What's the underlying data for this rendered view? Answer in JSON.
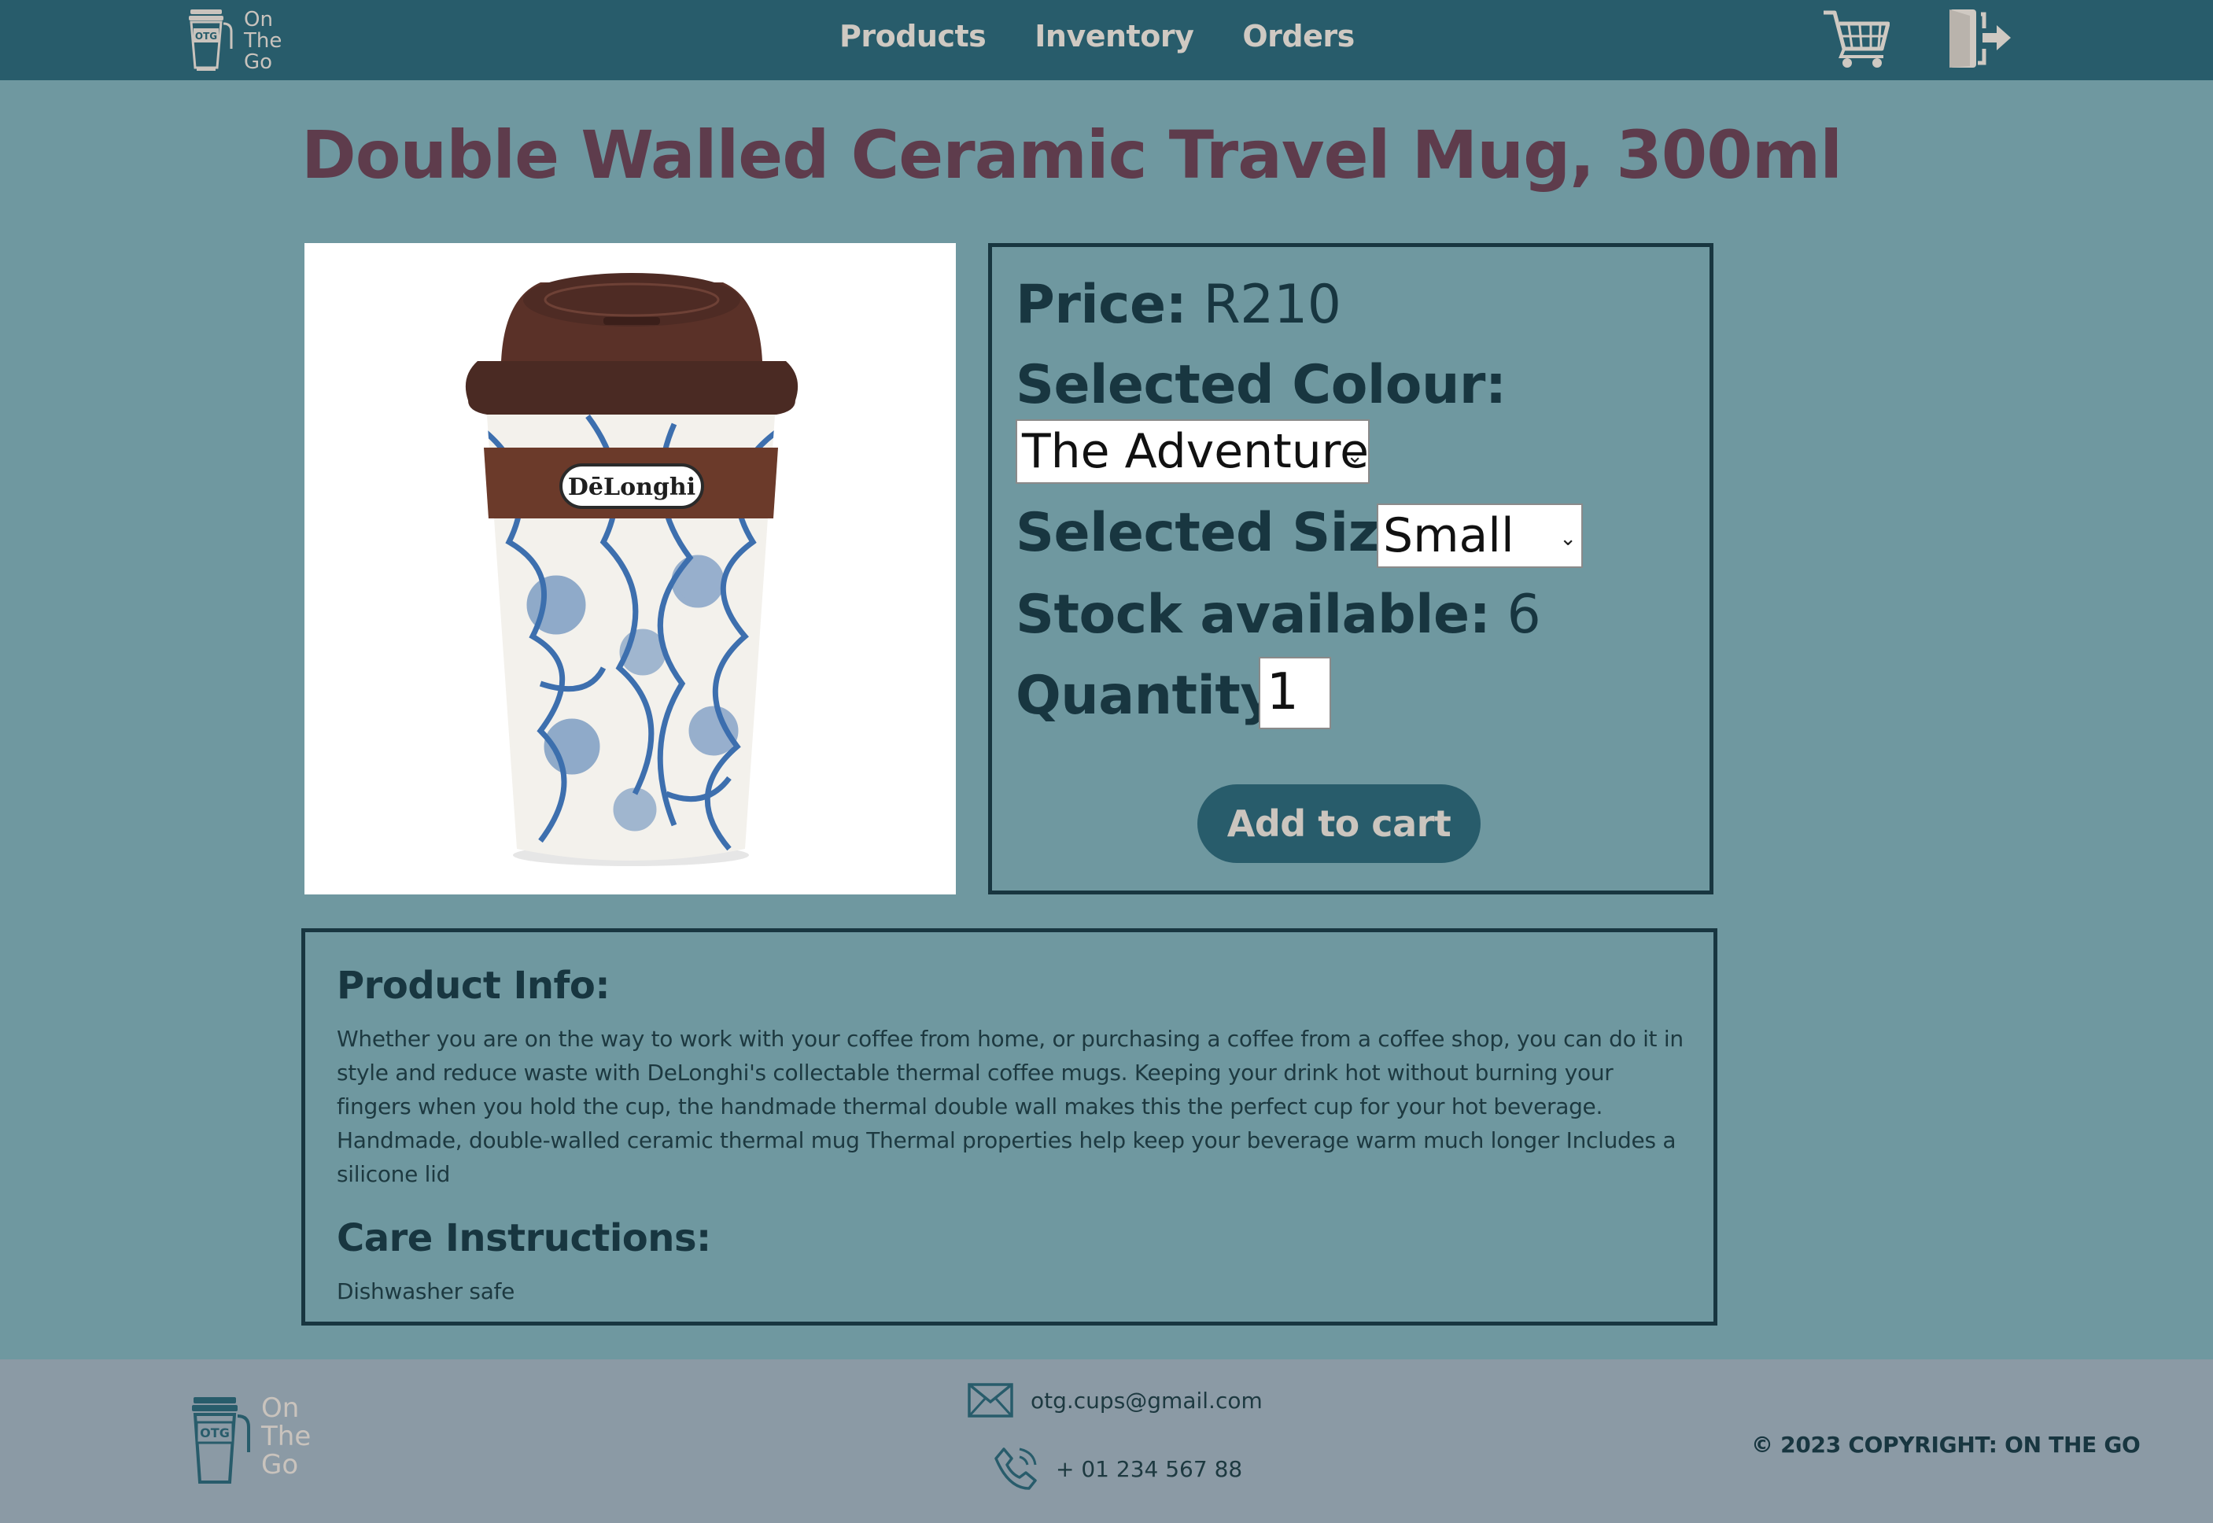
{
  "nav": {
    "logo_badge": "OTG",
    "logo_lines": [
      "On",
      "The",
      "Go"
    ],
    "links": [
      "Products",
      "Inventory",
      "Orders"
    ],
    "cart_icon": "shopping-cart-icon",
    "logout_icon": "logout-door-icon"
  },
  "product": {
    "title": "Double Walled Ceramic Travel Mug, 300ml",
    "image_brand": "DēLonghi",
    "price_label": "Price:",
    "price_value": "R210",
    "colour_label": "Selected Colour:",
    "colour_value": "The Adventurer",
    "size_label": "Selected Size:",
    "size_value": "Small",
    "stock_label": "Stock available:",
    "stock_value": "6",
    "quantity_label": "Quantity:",
    "quantity_value": "1",
    "add_to_cart": "Add to cart"
  },
  "info": {
    "heading": "Product Info:",
    "text": "Whether you are on the way to work with your coffee from home, or purchasing a coffee from a coffee shop, you can do it in style and reduce waste with DeLonghi's collectable thermal coffee mugs. Keeping your drink hot without burning your fingers when you hold the cup, the handmade thermal double wall makes this the perfect cup for your hot beverage. Handmade, double-walled ceramic thermal mug Thermal properties help keep your beverage warm much longer Includes a silicone lid",
    "care_heading": "Care Instructions:",
    "care_text": "Dishwasher safe"
  },
  "footer": {
    "email": "otg.cups@gmail.com",
    "phone": "+ 01 234 567 88",
    "copyright": "© 2023 COPYRIGHT: ON THE GO",
    "email_icon": "envelope-icon",
    "phone_icon": "phone-icon"
  },
  "colors": {
    "nav_bg": "#285c6b",
    "page_bg": "#6f98a0",
    "title": "#5e3c4c",
    "footer_bg": "#8b9aa5",
    "button_bg": "#285c6b"
  }
}
